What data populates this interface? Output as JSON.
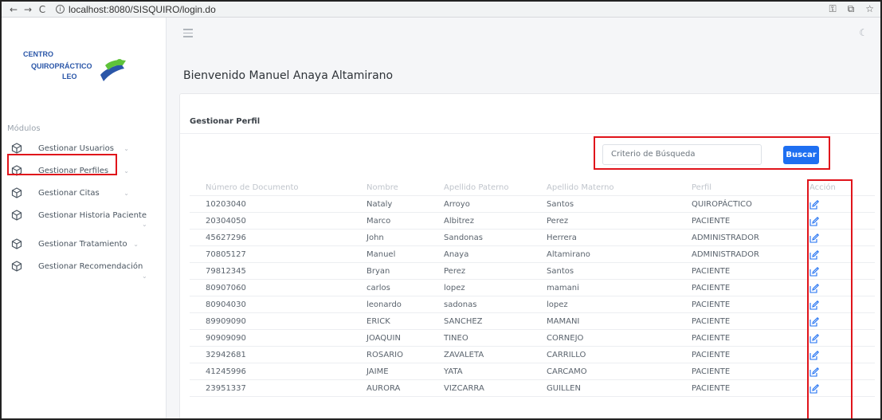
{
  "browser": {
    "url": "localhost:8080/SISQUIRO/login.do",
    "nav": [
      "←",
      "→",
      "C"
    ]
  },
  "brand": {
    "line1": "CENTRO",
    "line2": "QUIROPRÁCTICO",
    "line3": "LEO"
  },
  "sidebar": {
    "section_title": "Módulos",
    "items": [
      {
        "label": "Gestionar Usuarios"
      },
      {
        "label": "Gestionar Perfiles"
      },
      {
        "label": "Gestionar Citas"
      },
      {
        "label": "Gestionar Historia Paciente"
      },
      {
        "label": "Gestionar Tratamiento"
      },
      {
        "label": "Gestionar Recomendación"
      }
    ]
  },
  "main": {
    "welcome": "Bienvenido Manuel Anaya Altamirano",
    "card_title": "Gestionar Perfil",
    "search": {
      "placeholder": "Criterio de Búsqueda",
      "button": "Buscar"
    },
    "columns": [
      "Número de Documento",
      "Nombre",
      "Apellido Paterno",
      "Apellido Materno",
      "Perfil",
      "Acción"
    ],
    "rows": [
      [
        "10203040",
        "Nataly",
        "Arroyo",
        "Santos",
        "QUIROPÁCTICO"
      ],
      [
        "20304050",
        "Marco",
        "Albitrez",
        "Perez",
        "PACIENTE"
      ],
      [
        "45627296",
        "John",
        "Sandonas",
        "Herrera",
        "ADMINISTRADOR"
      ],
      [
        "70805127",
        "Manuel",
        "Anaya",
        "Altamirano",
        "ADMINISTRADOR"
      ],
      [
        "79812345",
        "Bryan",
        "Perez",
        "Santos",
        "PACIENTE"
      ],
      [
        "80907060",
        "carlos",
        "lopez",
        "mamani",
        "PACIENTE"
      ],
      [
        "80904030",
        "leonardo",
        "sadonas",
        "lopez",
        "PACIENTE"
      ],
      [
        "89909090",
        "ERICK",
        "SANCHEZ",
        "MAMANI",
        "PACIENTE"
      ],
      [
        "90909090",
        "JOAQUIN",
        "TINEO",
        "CORNEJO",
        "PACIENTE"
      ],
      [
        "32942681",
        "ROSARIO",
        "ZAVALETA",
        "CARRILLO",
        "PACIENTE"
      ],
      [
        "41245996",
        "JAIME",
        "YATA",
        "CARCAMO",
        "PACIENTE"
      ],
      [
        "23951337",
        "AURORA",
        "VIZCARRA",
        "GUILLEN",
        "PACIENTE"
      ]
    ]
  },
  "colors": {
    "accent": "#1e6ff1",
    "highlight": "#e0141b",
    "brand": "#2a56a8"
  }
}
